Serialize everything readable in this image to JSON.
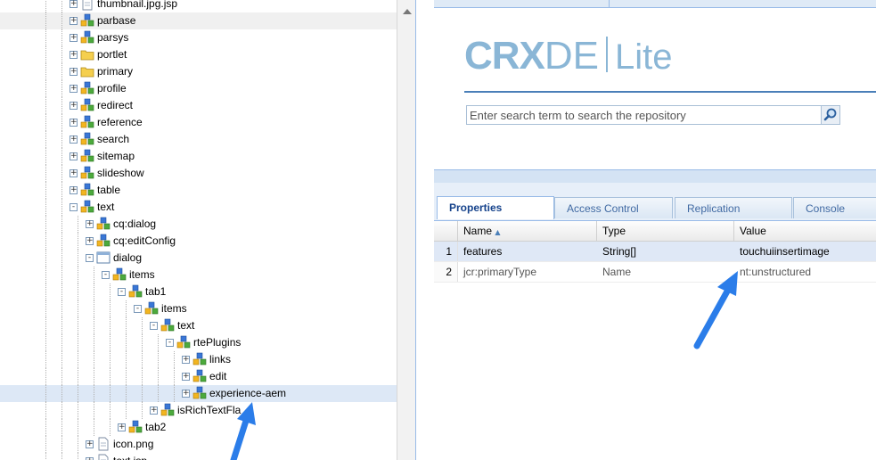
{
  "tree": {
    "rows": [
      {
        "label": "thumbnail.jpg.jsp",
        "depth": 1,
        "icon": "file-icon",
        "toggle": "+",
        "state": "normal"
      },
      {
        "label": "parbase",
        "depth": 1,
        "icon": "component-icon",
        "toggle": "+",
        "state": "hover"
      },
      {
        "label": "parsys",
        "depth": 1,
        "icon": "component-icon",
        "toggle": "+",
        "state": "normal"
      },
      {
        "label": "portlet",
        "depth": 1,
        "icon": "folder-icon",
        "toggle": "+",
        "state": "normal"
      },
      {
        "label": "primary",
        "depth": 1,
        "icon": "folder-icon",
        "toggle": "+",
        "state": "normal"
      },
      {
        "label": "profile",
        "depth": 1,
        "icon": "component-icon",
        "toggle": "+",
        "state": "normal"
      },
      {
        "label": "redirect",
        "depth": 1,
        "icon": "component-icon",
        "toggle": "+",
        "state": "normal"
      },
      {
        "label": "reference",
        "depth": 1,
        "icon": "component-icon",
        "toggle": "+",
        "state": "normal"
      },
      {
        "label": "search",
        "depth": 1,
        "icon": "component-icon",
        "toggle": "+",
        "state": "normal"
      },
      {
        "label": "sitemap",
        "depth": 1,
        "icon": "component-icon",
        "toggle": "+",
        "state": "normal"
      },
      {
        "label": "slideshow",
        "depth": 1,
        "icon": "component-icon",
        "toggle": "+",
        "state": "normal"
      },
      {
        "label": "table",
        "depth": 1,
        "icon": "component-icon",
        "toggle": "+",
        "state": "normal"
      },
      {
        "label": "text",
        "depth": 1,
        "icon": "component-icon",
        "toggle": "-",
        "state": "normal"
      },
      {
        "label": "cq:dialog",
        "depth": 2,
        "icon": "component-icon",
        "toggle": "+",
        "state": "normal"
      },
      {
        "label": "cq:editConfig",
        "depth": 2,
        "icon": "component-icon",
        "toggle": "+",
        "state": "normal"
      },
      {
        "label": "dialog",
        "depth": 2,
        "icon": "dialog-icon",
        "toggle": "-",
        "state": "normal"
      },
      {
        "label": "items",
        "depth": 3,
        "icon": "component-icon",
        "toggle": "-",
        "state": "normal"
      },
      {
        "label": "tab1",
        "depth": 4,
        "icon": "component-icon",
        "toggle": "-",
        "state": "normal"
      },
      {
        "label": "items",
        "depth": 5,
        "icon": "component-icon",
        "toggle": "-",
        "state": "normal"
      },
      {
        "label": "text",
        "depth": 6,
        "icon": "component-icon",
        "toggle": "-",
        "state": "normal"
      },
      {
        "label": "rtePlugins",
        "depth": 7,
        "icon": "component-icon",
        "toggle": "-",
        "state": "normal"
      },
      {
        "label": "links",
        "depth": 8,
        "icon": "component-icon",
        "toggle": "+",
        "state": "normal"
      },
      {
        "label": "edit",
        "depth": 8,
        "icon": "component-icon",
        "toggle": "+",
        "state": "normal"
      },
      {
        "label": "experience-aem",
        "depth": 8,
        "icon": "component-icon",
        "toggle": "+",
        "state": "selected"
      },
      {
        "label": "isRichTextFla",
        "depth": 6,
        "icon": "component-icon",
        "toggle": "+",
        "state": "normal"
      },
      {
        "label": "tab2",
        "depth": 4,
        "icon": "component-icon",
        "toggle": "+",
        "state": "normal"
      },
      {
        "label": "icon.png",
        "depth": 2,
        "icon": "file-icon",
        "toggle": "+",
        "state": "normal"
      },
      {
        "label": "text.jsp",
        "depth": 2,
        "icon": "file-icon",
        "toggle": "+",
        "state": "normal"
      }
    ]
  },
  "logo": {
    "crx": "CRX",
    "de": "DE",
    "lite": "Lite"
  },
  "search": {
    "placeholder": "Enter search term to search the repository",
    "value": ""
  },
  "tabs": [
    {
      "label": "Properties",
      "active": true
    },
    {
      "label": "Access Control",
      "active": false
    },
    {
      "label": "Replication",
      "active": false
    },
    {
      "label": "Console",
      "active": false
    }
  ],
  "grid": {
    "columns": [
      "Name",
      "Type",
      "Value"
    ],
    "sort_indicator": "▲",
    "rows": [
      {
        "num": "1",
        "name": "features",
        "type": "String[]",
        "value": "touchuiinsertimage",
        "selected": true
      },
      {
        "num": "2",
        "name": "jcr:primaryType",
        "type": "Name",
        "value": "nt:unstructured",
        "selected": false
      }
    ]
  },
  "colors": {
    "accent": "#15428b",
    "logo": "#8ab6d6",
    "arrow": "#2b7de9",
    "selection": "#dde8f6"
  }
}
